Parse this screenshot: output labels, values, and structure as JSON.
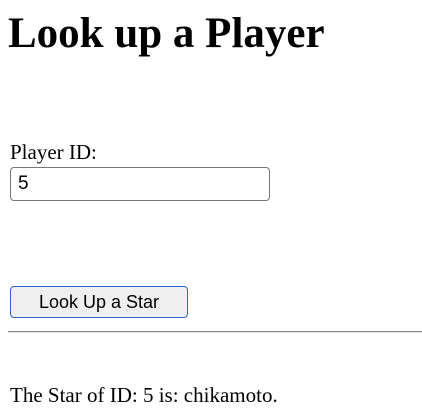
{
  "page": {
    "title": "Look up a Player"
  },
  "form": {
    "player_id_label": "Player ID:",
    "player_id_value": "5",
    "submit_label": "Look Up a Star"
  },
  "result": {
    "text": "The Star of ID: 5 is: chikamoto."
  },
  "colors": {
    "button_border_focus": "#2f64c8",
    "button_background": "#efefef",
    "input_border": "#767676",
    "divider": "#8a8a8a"
  }
}
